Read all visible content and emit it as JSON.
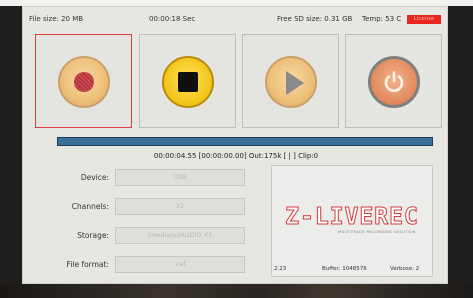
{
  "status_bar": {
    "file_size": "File size: 20 MB",
    "elapsed": "00:00:18 Sec",
    "free_sd": "Free SD size: 0.31 GB",
    "temp": "Temp: 53 C",
    "license": "License"
  },
  "controls": [
    {
      "name": "record",
      "icon": "record-icon",
      "selected": true
    },
    {
      "name": "stop",
      "icon": "stop-icon",
      "selected": false
    },
    {
      "name": "play",
      "icon": "play-icon",
      "selected": false
    },
    {
      "name": "power",
      "icon": "power-icon",
      "selected": false
    }
  ],
  "progress": {
    "fraction": 1.0
  },
  "time_info": "00:00:04.55 [00:00:00.00] Out:175k [ | ] Clip:0",
  "fields": {
    "device": {
      "label": "Device:",
      "value": "USB"
    },
    "channels": {
      "label": "Channels:",
      "value": "32"
    },
    "storage": {
      "label": "Storage:",
      "value": "/media/pi/AUDIO X1"
    },
    "file_format": {
      "label": "File format:",
      "value": ".caf"
    }
  },
  "logo": {
    "text": "Z-LIVEREC",
    "subtitle": "MULTITRACK RECORDING SOLUTION"
  },
  "info": {
    "version": "2.23",
    "buffer": "Buffer: 1048576",
    "verbose": "Verbose: 2"
  },
  "colors": {
    "license_bg": "#e8261e",
    "progress": "#2e5f88",
    "selected_border": "#e33b3b",
    "logo_stroke": "#d23c3c"
  }
}
